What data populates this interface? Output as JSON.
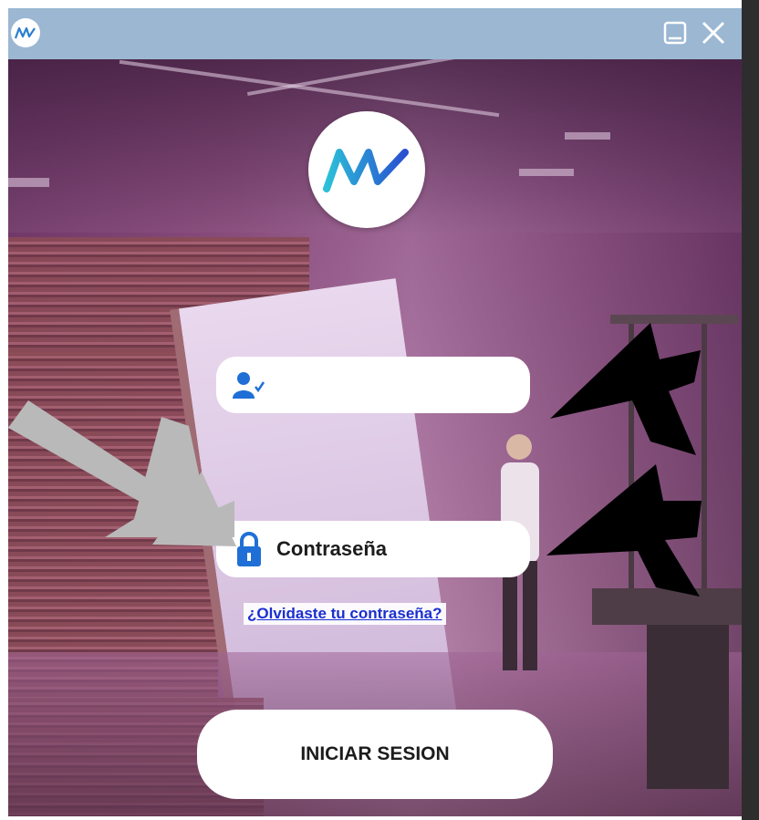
{
  "titlebar": {
    "logo_text": "MV",
    "icons": [
      "maximize-icon",
      "close-icon"
    ]
  },
  "logo": {
    "text": "MV"
  },
  "form": {
    "user_placeholder": "",
    "user_icon": "user-check-icon",
    "password_placeholder": "Contraseña",
    "password_icon": "lock-icon",
    "forgot_link": "¿Olvidaste tu contraseña?",
    "login_button": "INICIAR SESION"
  },
  "colors": {
    "titlebar": "#9bb7d2",
    "accent_blue": "#1f6fd6",
    "logo_teal": "#2bc0d8",
    "logo_blue": "#2a4fd0",
    "annotation_gray": "#b9b9b9",
    "annotation_black": "#000000"
  }
}
